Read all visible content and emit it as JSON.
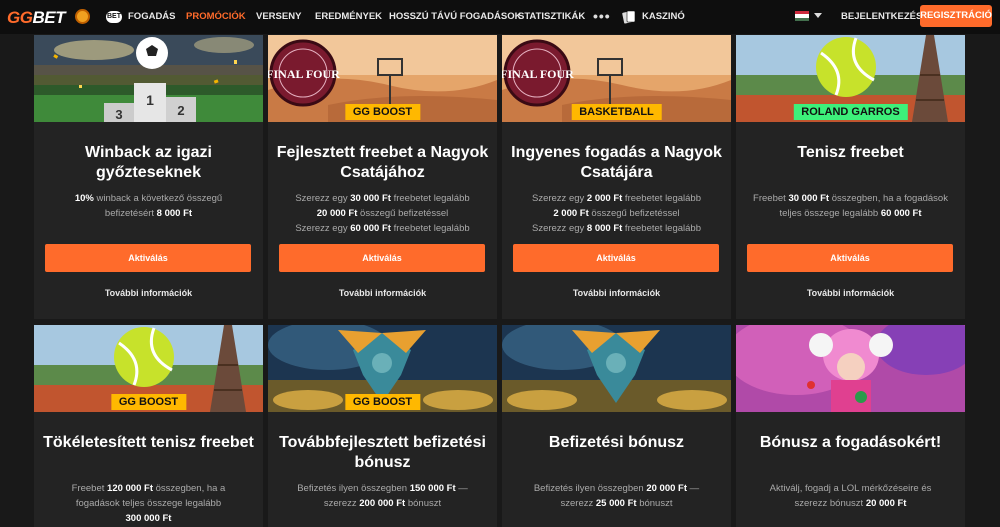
{
  "nav": {
    "logo_left": "GG",
    "logo_right": "BET",
    "bet_badge": "BET",
    "items": [
      "FOGADÁS",
      "PROMÓCIÓK",
      "VERSENY",
      "EREDMÉNYEK",
      "HOSSZÚ TÁVÚ FOGADÁSOK",
      "STATISZTIKÁK"
    ],
    "more": "•••",
    "casino": "KASZINÓ",
    "login": "BEJELENTKEZÉS",
    "register": "REGISZTRÁCIÓ"
  },
  "cards": [
    {
      "tag": "",
      "title_lines": [
        "Winback az igazi",
        "győzteseknek"
      ],
      "desc_lines": [
        [
          {
            "b": "10%"
          },
          {
            "t": " winback a következő összegű"
          }
        ],
        [
          {
            "t": "befizetésért "
          },
          {
            "b": "8 000 Ft"
          }
        ]
      ],
      "button": "Aktiválás",
      "more": "További információk"
    },
    {
      "tag": "GG BOOST",
      "title_lines": [
        "Fejlesztett freebet a Nagyok",
        "Csatájához"
      ],
      "desc_lines": [
        [
          {
            "t": "Szerezz egy "
          },
          {
            "b": "30 000 Ft"
          },
          {
            "t": " freebetet legalább"
          }
        ],
        [
          {
            "b": "20 000 Ft"
          },
          {
            "t": " összegű befizetéssel"
          }
        ],
        [
          {
            "t": "Szerezz egy "
          },
          {
            "b": "60 000 Ft"
          },
          {
            "t": " freebetet legalább"
          }
        ]
      ],
      "button": "Aktiválás",
      "more": "További információk"
    },
    {
      "tag": "BASKETBALL",
      "title_lines": [
        "Ingyenes fogadás a Nagyok",
        "Csatájára"
      ],
      "desc_lines": [
        [
          {
            "t": "Szerezz egy "
          },
          {
            "b": "2 000 Ft"
          },
          {
            "t": " freebetet legalább"
          }
        ],
        [
          {
            "b": "2 000 Ft"
          },
          {
            "t": " összegű befizetéssel"
          }
        ],
        [
          {
            "t": "Szerezz egy "
          },
          {
            "b": "8 000 Ft"
          },
          {
            "t": " freebetet legalább"
          }
        ]
      ],
      "button": "Aktiválás",
      "more": "További információk"
    },
    {
      "tag": "ROLAND GARROS",
      "title_lines": [
        "Tenisz freebet"
      ],
      "desc_lines": [
        [
          {
            "t": "Freebet "
          },
          {
            "b": "30 000 Ft"
          },
          {
            "t": " összegben, ha a fogadások"
          }
        ],
        [
          {
            "t": "teljes összege legalább "
          },
          {
            "b": "60 000 Ft"
          }
        ]
      ],
      "button": "Aktiválás",
      "more": "További információk"
    },
    {
      "tag": "GG BOOST",
      "title_lines": [
        "Tökéletesített tenisz freebet"
      ],
      "desc_lines": [
        [
          {
            "t": "Freebet "
          },
          {
            "b": "120 000 Ft"
          },
          {
            "t": " összegben, ha a"
          }
        ],
        [
          {
            "t": "fogadások teljes összege legalább"
          }
        ],
        [
          {
            "b": "300 000 Ft"
          }
        ]
      ]
    },
    {
      "tag": "GG BOOST",
      "title_lines": [
        "Továbbfejlesztett befizetési",
        "bónusz"
      ],
      "desc_lines": [
        [
          {
            "t": "Befizetés ilyen összegben "
          },
          {
            "b": "150 000 Ft"
          },
          {
            "t": " —"
          }
        ],
        [
          {
            "t": "szerezz "
          },
          {
            "b": "200 000 Ft"
          },
          {
            "t": " bónuszt"
          }
        ]
      ]
    },
    {
      "tag": "",
      "title_lines": [
        "Befizetési bónusz"
      ],
      "desc_lines": [
        [
          {
            "t": "Befizetés ilyen összegben "
          },
          {
            "b": "20 000 Ft"
          },
          {
            "t": " —"
          }
        ],
        [
          {
            "t": "szerezz "
          },
          {
            "b": "25 000 Ft"
          },
          {
            "t": " bónuszt"
          }
        ]
      ]
    },
    {
      "tag": "",
      "title_lines": [
        "Bónusz a fogadásokért!"
      ],
      "desc_lines": [
        [
          {
            "t": "Aktiválj, fogadj a LOL mérkőzéseire és"
          }
        ],
        [
          {
            "t": "szerezz bónuszt "
          },
          {
            "b": "20 000 Ft"
          }
        ]
      ]
    }
  ],
  "image_labels": {
    "final_four": "FINAL FOUR",
    "podium": [
      "3",
      "1",
      "2"
    ]
  },
  "colors": {
    "accent": "#ff6b2b",
    "background": "#191919",
    "card": "#232323",
    "tag_orange": "#ffb800",
    "tag_green": "#3df07a"
  }
}
